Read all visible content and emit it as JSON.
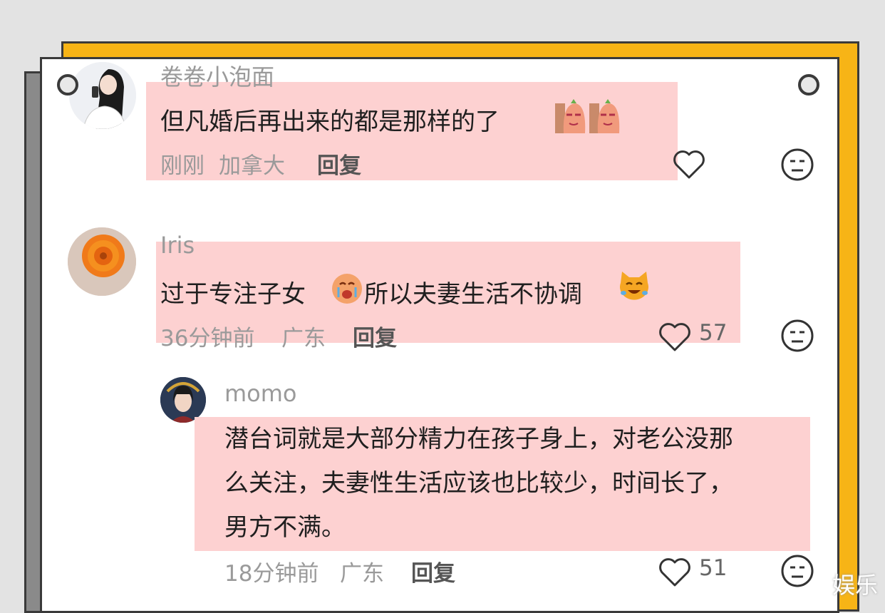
{
  "comments": [
    {
      "username": "卷卷小泡面",
      "text": "但凡婚后再出来的都是那样的了",
      "time": "刚刚",
      "location": "加拿大",
      "reply": "回复",
      "likes": ""
    },
    {
      "username": "Iris",
      "text_a": "过于专注子女",
      "text_b": "所以夫妻生活不协调",
      "time": "36分钟前",
      "location": "广东",
      "reply": "回复",
      "likes": "57"
    },
    {
      "username": "momo",
      "lines": [
        "潜台词就是大部分精力在孩子身上，对老公没那",
        "么关注，夫妻性生活应该也比较少，时间长了，",
        "男方不满。"
      ],
      "time": "18分钟前",
      "location": "广东",
      "reply": "回复",
      "likes": "51"
    }
  ],
  "watermark": "娱乐",
  "colors": {
    "highlight": "#fdd1d1",
    "frame_yellow": "#f7b416",
    "frame_gray": "#8a8a8a",
    "border": "#3a3a3a"
  }
}
